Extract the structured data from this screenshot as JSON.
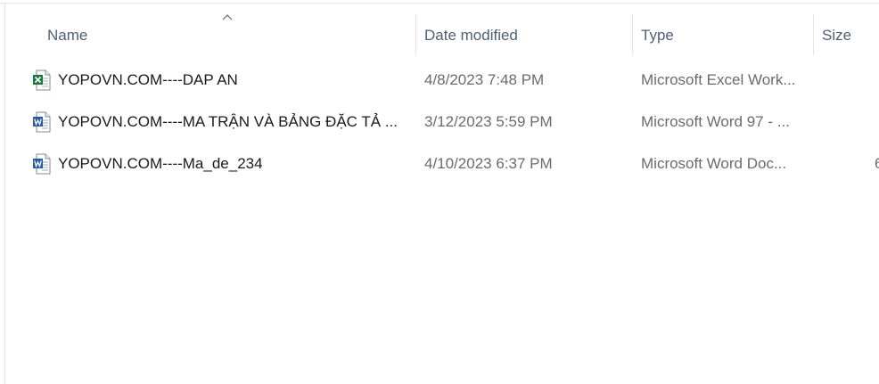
{
  "header": {
    "columns": {
      "name": "Name",
      "date_modified": "Date modified",
      "type": "Type",
      "size": "Size"
    }
  },
  "files": [
    {
      "name": "YOPOVN.COM----DAP AN",
      "date_modified": "4/8/2023 7:48 PM",
      "type": "Microsoft Excel Work...",
      "size": "",
      "icon": "excel-file-icon"
    },
    {
      "name": "YOPOVN.COM----MA TRẬN VÀ BẢNG ĐẶC TẢ ...",
      "date_modified": "3/12/2023 5:59 PM",
      "type": "Microsoft Word 97 - ...",
      "size": "",
      "icon": "word-file-icon"
    },
    {
      "name": "YOPOVN.COM----Ma_de_234",
      "date_modified": "4/10/2023 6:37 PM",
      "type": "Microsoft Word Doc...",
      "size": "6",
      "icon": "word-file-icon"
    }
  ],
  "colors": {
    "header_text": "#4c607a",
    "excel_green": "#1d7a3e",
    "word_blue": "#2b5aa8"
  }
}
